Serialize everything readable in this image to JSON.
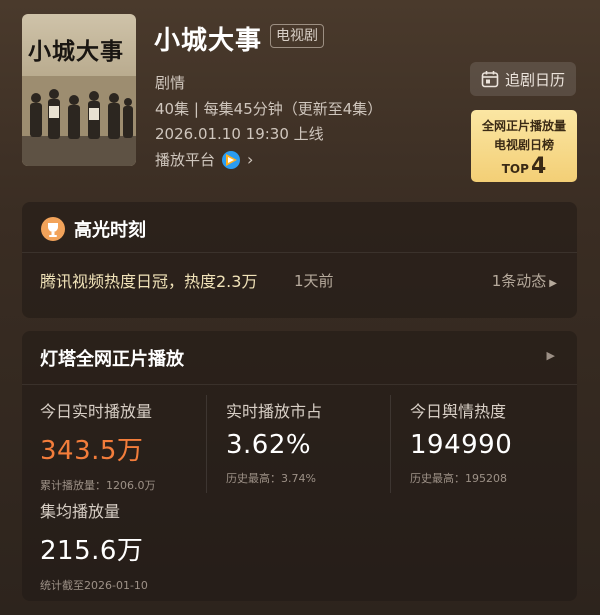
{
  "poster": {
    "title": "小城大事"
  },
  "show": {
    "title": "小城大事",
    "type_badge": "电视剧",
    "genre": "剧情",
    "episodes": "40集 | 每集45分钟（更新至4集）",
    "air_time": "2026.01.10 19:30 上线",
    "platform_label": "播放平台"
  },
  "calendar_button": {
    "label": "追剧日历"
  },
  "rank_card": {
    "line1": "全网正片播放量",
    "line2": "电视剧日榜",
    "top_label": "TOP",
    "rank": "4"
  },
  "highlight": {
    "title": "高光时刻",
    "news": "腾讯视频热度日冠，热度2.3万",
    "time": "1天前",
    "dynamics": "1条动态"
  },
  "stats": {
    "title": "灯塔全网正片播放",
    "items": [
      {
        "label": "今日实时播放量",
        "value": "343.5万",
        "sub": "累计播放量：1206.0万"
      },
      {
        "label": "实时播放市占",
        "value": "3.62%",
        "sub": "历史最高：3.74%"
      },
      {
        "label": "今日舆情热度",
        "value": "194990",
        "sub": "历史最高：195208"
      },
      {
        "label": "集均播放量",
        "value": "215.6万",
        "sub": "统计截至2026-01-10"
      }
    ]
  },
  "colors": {
    "accent_orange": "#f37d3b",
    "rank_gold": "#f3cf76",
    "highlight_text": "#f0e2b8"
  }
}
